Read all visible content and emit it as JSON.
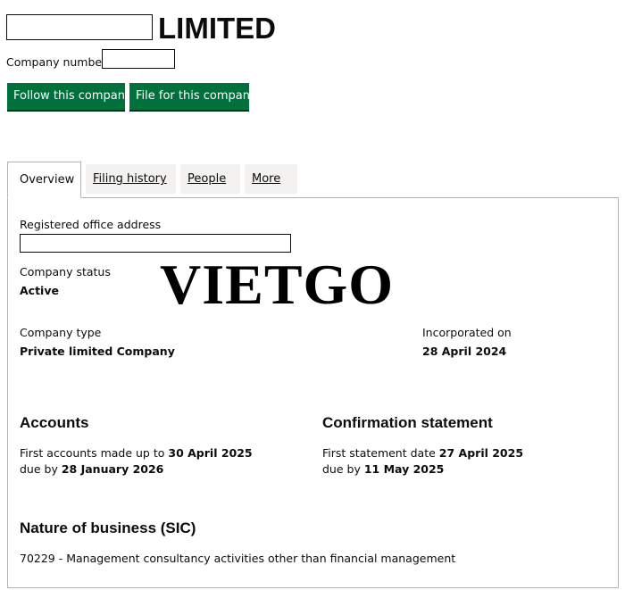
{
  "header": {
    "title_suffix": "LIMITED",
    "company_number_label": "Company number"
  },
  "actions": {
    "follow_label": "Follow this company",
    "file_label": "File for this company"
  },
  "tabs": [
    {
      "label": "Overview",
      "active": true
    },
    {
      "label": "Filing history",
      "active": false
    },
    {
      "label": "People",
      "active": false
    },
    {
      "label": "More",
      "active": false
    }
  ],
  "overview": {
    "registered_office_label": "Registered office address",
    "status_label": "Company status",
    "status_value": "Active",
    "type_label": "Company type",
    "type_value": "Private limited Company",
    "incorporated_label": "Incorporated on",
    "incorporated_value": "28 April 2024"
  },
  "accounts": {
    "heading": "Accounts",
    "line1_prefix": "First accounts made up to",
    "line1_value": "30 April 2025",
    "line2_prefix": "due by",
    "line2_value": "28 January 2026"
  },
  "confirmation": {
    "heading": "Confirmation statement",
    "line1_prefix": "First statement date",
    "line1_value": "27 April 2025",
    "line2_prefix": "due by",
    "line2_value": "11 May 2025"
  },
  "nature": {
    "heading": "Nature of business (SIC)",
    "sic": "70229 - Management consultancy activities other than financial management"
  },
  "watermark": "VIETGO",
  "colors": {
    "button_green": "#00703c",
    "tab_inactive": "#f3f2f1",
    "border": "#b1b4b6"
  }
}
